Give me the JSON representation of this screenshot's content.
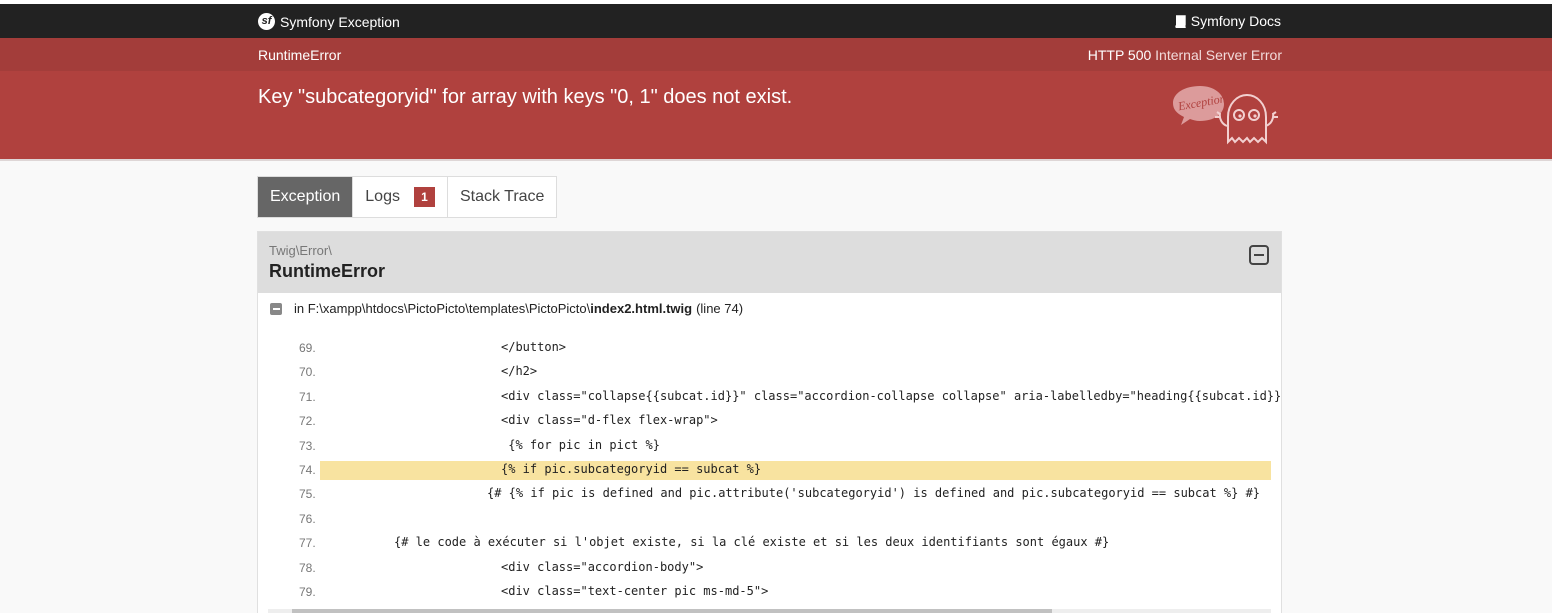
{
  "header": {
    "brand_label": "Symfony Exception",
    "docs_label": "Symfony Docs"
  },
  "exception": {
    "class_label": "RuntimeError",
    "http_code": "HTTP 500",
    "http_text": "Internal Server Error",
    "message": "Key \"subcategoryid\" for array with keys \"0, 1\" does not exist."
  },
  "tabs": [
    {
      "label": "Exception",
      "active": true
    },
    {
      "label": "Logs",
      "badge": "1"
    },
    {
      "label": "Stack Trace"
    }
  ],
  "trace": {
    "namespace": "Twig\\Error\\",
    "class_name": "RuntimeError",
    "file_prefix": "in F:\\xampp\\htdocs\\PictoPicto\\templates\\PictoPicto\\",
    "file_name": "index2.html.twig",
    "line_info": "(line 74)",
    "lines": [
      {
        "num": "69.",
        "code": "</button>"
      },
      {
        "num": "70.",
        "code": "</h2>"
      },
      {
        "num": "71.",
        "code": "<div class=\"collapse{{subcat.id}}\" class=\"accordion-collapse collapse\" aria-labelledby=\"heading{{subcat.id}}"
      },
      {
        "num": "72.",
        "code": "<div class=\"d-flex flex-wrap\">"
      },
      {
        "num": "73.",
        "code": " {% for pic in pict %}"
      },
      {
        "num": "74.",
        "code": "{% if pic.subcategoryid == subcat %}",
        "highlight": true
      },
      {
        "num": "75.",
        "code": "{# {% if pic is defined and pic.attribute('subcategoryid') is defined and pic.subcategoryid == subcat %} #}"
      },
      {
        "num": "76.",
        "code": ""
      },
      {
        "num": "77.",
        "code": "{# le code à exécuter si l'objet existe, si la clé existe et si les deux identifiants sont égaux #}"
      },
      {
        "num": "78.",
        "code": "<div class=\"accordion-body\">"
      },
      {
        "num": "79.",
        "code": "<div class=\"text-center pic ms-md-5\">"
      }
    ]
  },
  "logo_text": "Exception!"
}
